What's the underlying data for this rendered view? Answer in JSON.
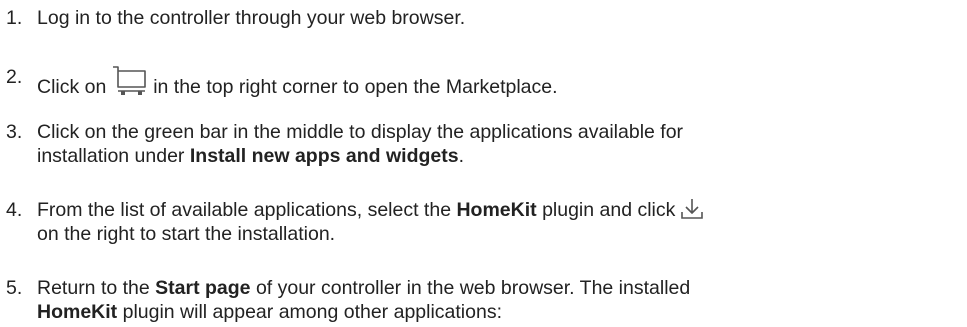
{
  "steps": [
    {
      "number": "1.",
      "text": "Log in to the controller through your web browser."
    },
    {
      "number": "2.",
      "before": "Click on",
      "icon": "shopping-cart-icon",
      "after": "in the top right corner to open the Marketplace."
    },
    {
      "number": "3.",
      "line1": "Click on the green bar in the middle to display the applications available for",
      "line2_before": "installation under",
      "line2_bold": "Install new apps and widgets",
      "line2_after": "."
    },
    {
      "number": "4.",
      "line1_before": "From the list of available applications, select the",
      "line1_bold": "HomeKit",
      "line1_after": "plugin and click",
      "icon": "download-icon",
      "line2": "on the right to start the installation."
    },
    {
      "number": "5.",
      "line1_before": "Return to the",
      "line1_bold": "Start page",
      "line1_after": "of your controller in the web browser. The installed",
      "line2_bold": "HomeKit",
      "line2_after": "plugin will appear among other applications:"
    }
  ],
  "colors": {
    "text": "#222222",
    "icon": "#555555"
  }
}
